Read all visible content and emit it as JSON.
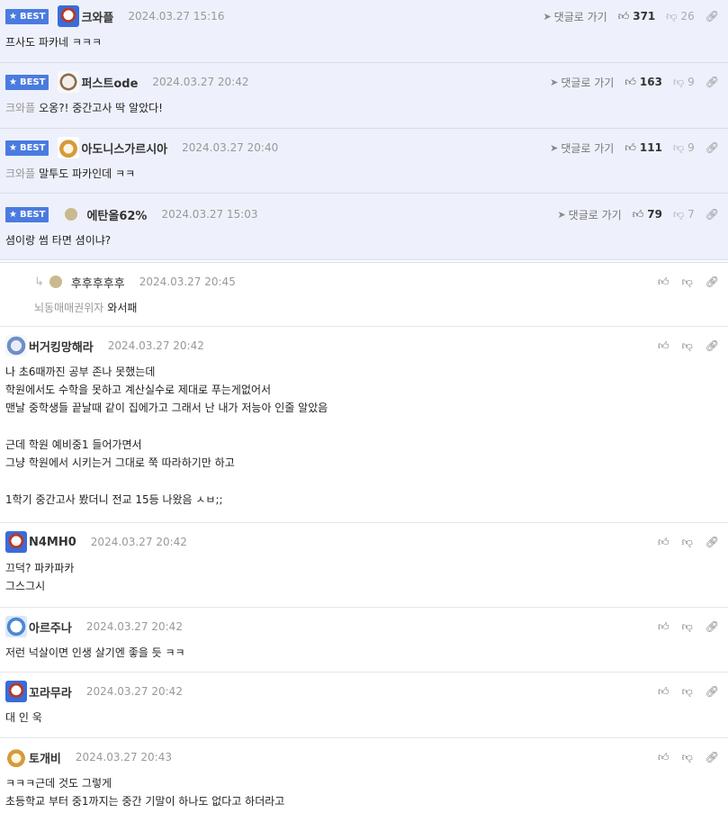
{
  "labels": {
    "best": "BEST",
    "reply_link": "댓글로 가기"
  },
  "comments": [
    {
      "best": true,
      "author": "크와플",
      "date": "2024.03.27 15:16",
      "up": "371",
      "down": "26",
      "mention": "",
      "lines": [
        "프사도 파카네 ㅋㅋㅋ"
      ]
    },
    {
      "best": true,
      "author": "퍼스트ode",
      "date": "2024.03.27 20:42",
      "up": "163",
      "down": "9",
      "mention": "크와플",
      "lines": [
        "오옹?! 중간고사 딱 알았다!"
      ]
    },
    {
      "best": true,
      "author": "아도니스가르시아",
      "date": "2024.03.27 20:40",
      "up": "111",
      "down": "9",
      "mention": "크와플",
      "lines": [
        "말투도 파카인데 ㅋㅋ"
      ]
    },
    {
      "best": true,
      "author": "에탄올62%",
      "date": "2024.03.27 15:03",
      "up": "79",
      "down": "7",
      "mention": "",
      "lines": [
        "셤이랑 썸 타면 셤이냐?"
      ]
    },
    {
      "reply": true,
      "author": "후후후후후",
      "date": "2024.03.27 20:45",
      "mention": "뇌동매매권위자",
      "lines": [
        "와서패"
      ]
    },
    {
      "author": "버거킹망해라",
      "date": "2024.03.27 20:42",
      "mention": "",
      "lines": [
        "나 초6때까진 공부 존나 못했는데",
        "학원에서도 수학을 못하고 계산실수로 제대로 푸는게없어서",
        "맨날 중학생들 끝날때 같이 집에가고 그래서 난 내가 저능아 인줄 알았음",
        "",
        "근데 학원 예비중1 들어가면서",
        "그냥 학원에서 시키는거 그대로 쭉 따라하기만 하고",
        "",
        "1학기 중간고사 봤더니 전교 15등 나왔음 ㅅㅂ;;"
      ]
    },
    {
      "author": "N4MH0",
      "date": "2024.03.27 20:42",
      "mention": "",
      "lines": [
        "끄덕? 파카파카",
        "그스그시"
      ]
    },
    {
      "author": "아르주나",
      "date": "2024.03.27 20:42",
      "mention": "",
      "lines": [
        "저런 넉살이면 인생 살기엔 좋을 듯 ㅋㅋ"
      ]
    },
    {
      "author": "꼬라무라",
      "date": "2024.03.27 20:42",
      "mention": "",
      "lines": [
        "대 인 욱"
      ]
    },
    {
      "author": "토개비",
      "date": "2024.03.27 20:43",
      "mention": "",
      "lines": [
        "ㅋㅋㅋ근데 것도 그렇게",
        "초등학교 부터 중1까지는 중간 기말이 하나도 없다고 하더라고"
      ]
    }
  ]
}
